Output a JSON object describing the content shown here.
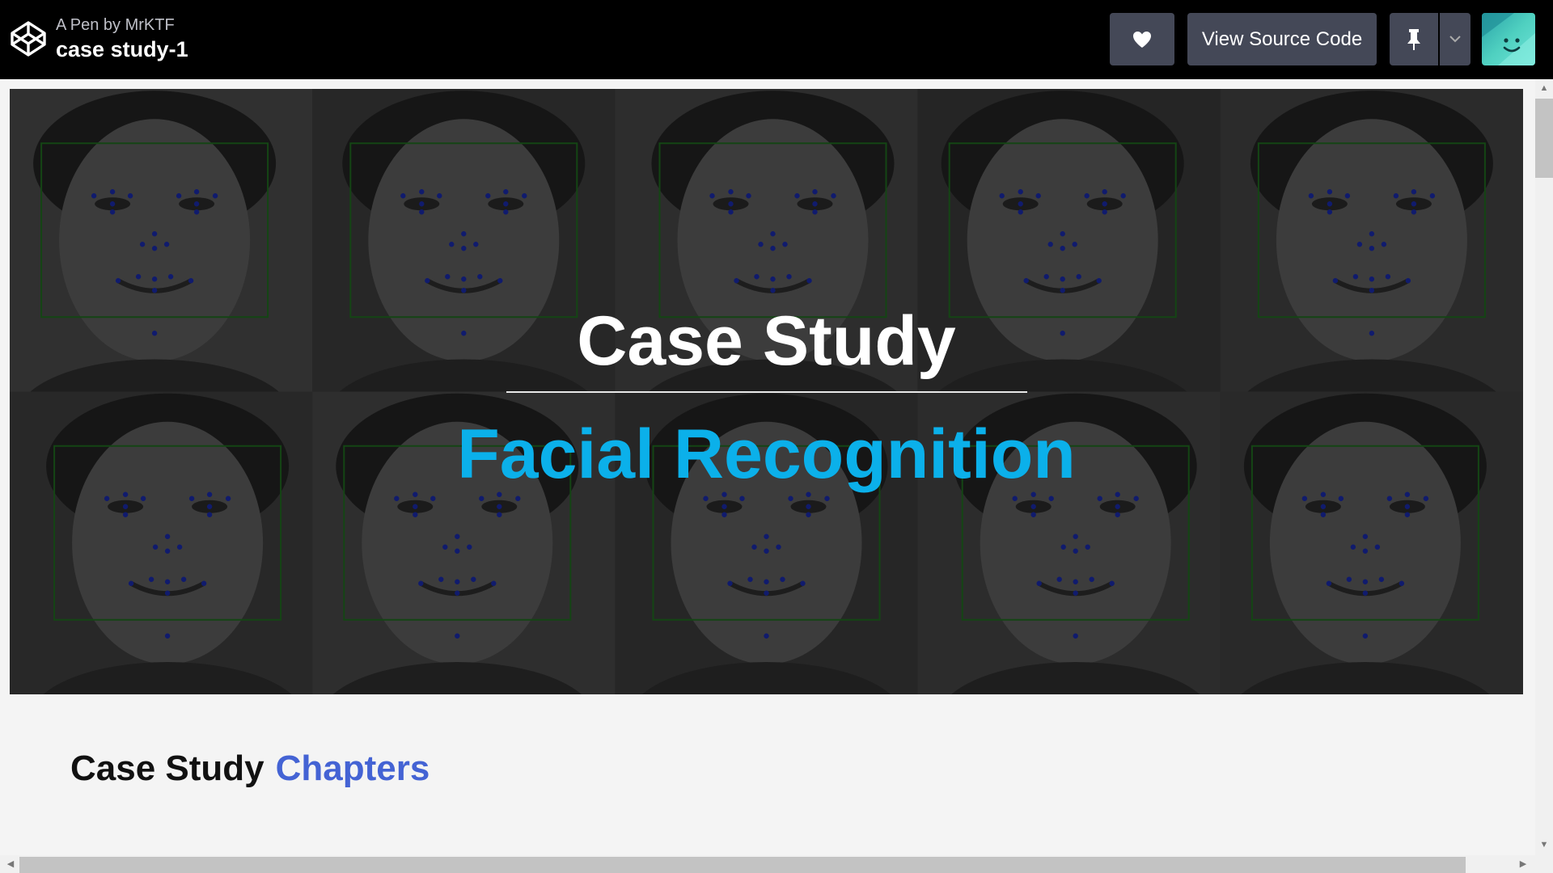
{
  "header": {
    "byline": "A Pen by MrKTF",
    "title": "case study-1",
    "view_source_label": "View Source Code",
    "icons": {
      "logo": "codepen-logo-icon",
      "heart": "heart-icon",
      "pin": "pin-icon",
      "caret": "chevron-down-icon",
      "avatar": "user-avatar"
    }
  },
  "hero": {
    "title": "Case Study",
    "subtitle": "Facial Recognition",
    "colors": {
      "title": "#ffffff",
      "subtitle": "#0bb0ea",
      "face_box": "#1f6b1f",
      "landmark": "#1a2aa8"
    }
  },
  "section": {
    "heading_plain": "Case Study",
    "heading_accent": "Chapters",
    "accent_color": "#4463d4"
  },
  "scrollbars": {
    "up": "▲",
    "down": "▼",
    "left": "◀",
    "right": "▶"
  }
}
